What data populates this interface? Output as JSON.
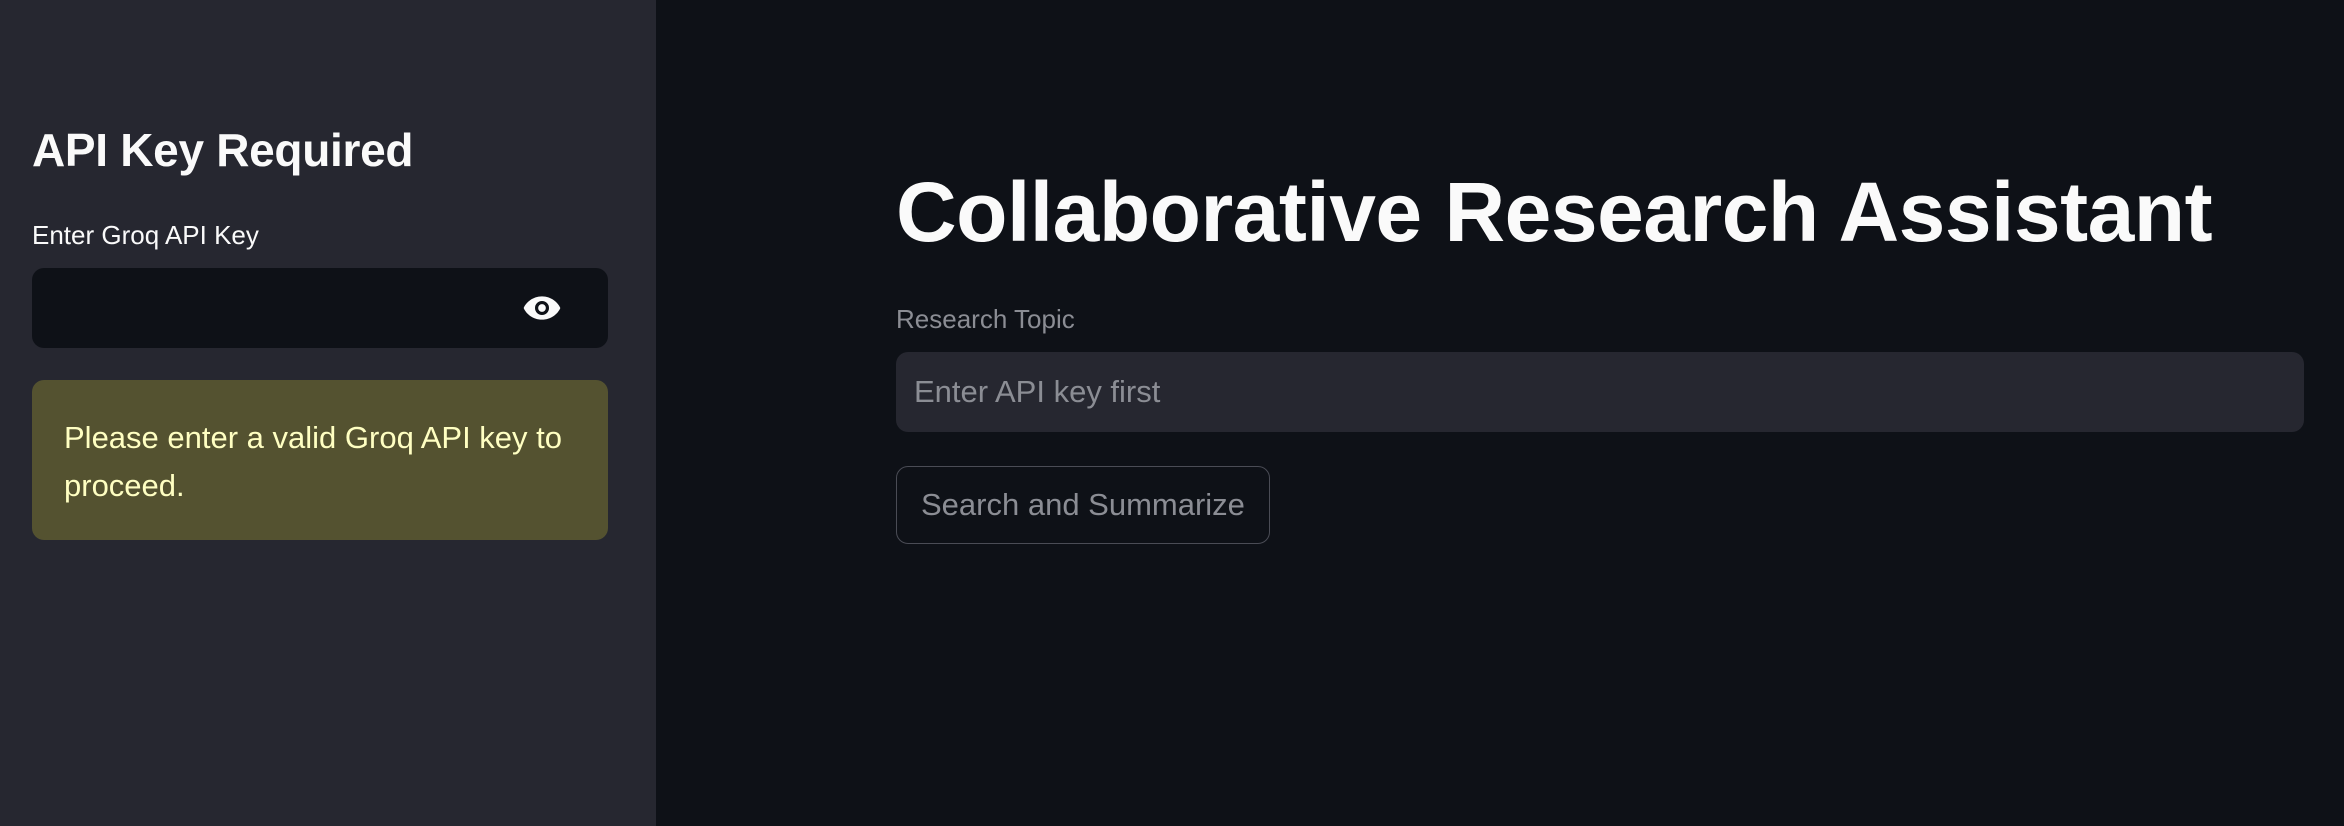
{
  "sidebar": {
    "heading": "API Key Required",
    "api_key_label": "Enter Groq API Key",
    "api_key_value": "",
    "visibility_icon": "eye-icon",
    "warning_message": "Please enter a valid Groq API key to proceed.",
    "warning_background": "#545230",
    "warning_text_color": "#ffffc2"
  },
  "main": {
    "title": "Collaborative Research Assistant",
    "topic_label": "Research Topic",
    "topic_placeholder": "Enter API key first",
    "topic_value": "",
    "submit_label": "Search and Summarize"
  },
  "theme": {
    "background": "#0e1117",
    "sidebar_background": "#262730",
    "text": "#fafafa",
    "muted_text": "#8b8d94"
  }
}
